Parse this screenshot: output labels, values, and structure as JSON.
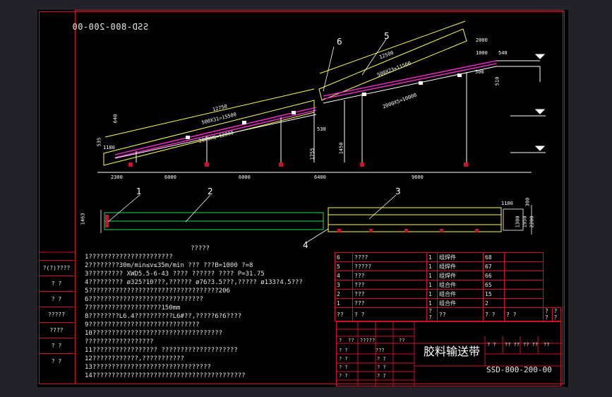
{
  "drawing_number_mirrored": "SSD-800-200-00",
  "callouts": [
    "1",
    "2",
    "3",
    "4",
    "5",
    "6"
  ],
  "elevation_dims": {
    "d12750": "12750",
    "s500x31": "500X31=15500",
    "s2000x6": "2000X6=12000",
    "d12500": "12500",
    "s500x23": "500X23=11500",
    "s2000x5": "2000X5=10000",
    "d2000": "2000",
    "d1000": "1000",
    "d540": "540",
    "d500": "500",
    "d640": "640",
    "d535": "535",
    "d1180": "1180",
    "d1755": "1755",
    "d1450": "1450",
    "d530": "530",
    "d510": "510"
  },
  "base_dims": [
    "2300",
    "6000",
    "6000",
    "6400",
    "9600"
  ],
  "plan_dims": {
    "w1100": "1100",
    "w1300": "1300",
    "w1950": "1950",
    "w2200": "2200",
    "w300": "300",
    "left": "1463"
  },
  "notes_title": "?????",
  "notes": [
    "1??????????????????????",
    "2????????30m/min≤v≤35m/min      ???    ???B=1000    ?=8",
    "3?????????    XWD5.5-6-43       ????  ??????  ????  P=31.75",
    "4?????????    ø325?10???,??????     ø76?3.5???,?????    ø133?4.5???",
    "5??????????????????????????????????206",
    "6??????????????????????????????",
    "7???????????????????150mm",
    "8????????L6.4??????????L6#??,?????6?6????",
    "9?????????????????????????????",
    "10??????????????????????????????????",
    "     ??????????????????",
    "11?????????????????  ????????????????????",
    "12????????????,???????????",
    "13???????????????????????????????",
    "14????????????????????????????????????????"
  ],
  "left_cells": [
    "?(?)????",
    "?   ?",
    "?   ?",
    "?????",
    "????",
    "?   ?",
    "?   ?"
  ],
  "parts_table": [
    {
      "no": "6",
      "name": "????",
      "qty": "1",
      "spec": "组焊件",
      "code": "68"
    },
    {
      "no": "5",
      "name": "?????",
      "qty": "1",
      "spec": "组焊件",
      "code": "67"
    },
    {
      "no": "4",
      "name": "???",
      "qty": "1",
      "spec": "组焊件",
      "code": "66"
    },
    {
      "no": "3",
      "name": "???",
      "qty": "1",
      "spec": "组合件",
      "code": "65"
    },
    {
      "no": "2",
      "name": "???",
      "qty": "1",
      "spec": "组合件",
      "code": "15"
    },
    {
      "no": "1",
      "name": "???",
      "qty": "1",
      "spec": "组合件",
      "code": "2"
    }
  ],
  "parts_header": [
    "??",
    "?  ?",
    "?  ?",
    "??",
    "?    ?",
    "?  ?",
    "?  ?",
    "?  ?"
  ],
  "title_block": {
    "name": "胶料输送带",
    "code": "SSD-800-200-00",
    "revision_cells": [
      "?",
      "??",
      "?",
      "?????",
      "?",
      "??",
      "?"
    ],
    "sign_cells": [
      "? ?",
      "? ?",
      "???",
      "? ?",
      "? ?",
      "? ?",
      "? ?",
      "? ?",
      "? ?"
    ],
    "scale_cells": [
      "? ?",
      "?? ??",
      "?? ??",
      "??"
    ]
  },
  "colors": {
    "frame": "#d0102a",
    "paper": "#000000",
    "belt": "#ffff44",
    "magenta": "#ff2bd6",
    "green": "#22dd55",
    "white": "#ffffff"
  }
}
